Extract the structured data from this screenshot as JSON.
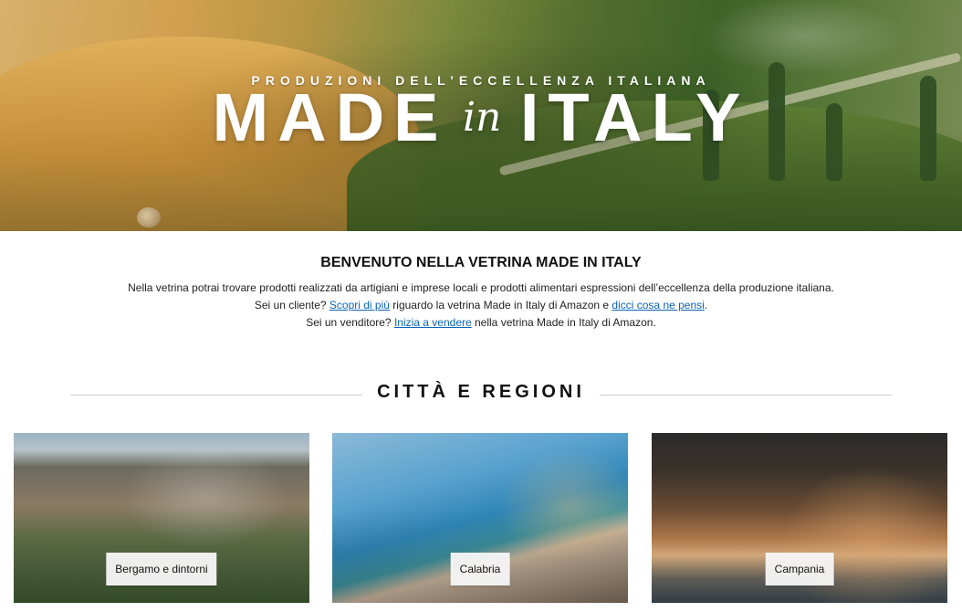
{
  "hero": {
    "subtitle": "PRODUZIONI DELL’ECCELLENZA ITALIANA",
    "title_left": "MADE",
    "title_middle": "in",
    "title_right": "ITALY"
  },
  "welcome": {
    "title": "BENVENUTO NELLA VETRINA MADE IN ITALY",
    "line1": "Nella vetrina potrai trovare prodotti realizzati da artigiani e imprese locali e prodotti alimentari espressioni dell’eccellenza della produzione italiana.",
    "line2_prefix": "Sei un cliente? ",
    "line2_link1": "Scopri di più",
    "line2_middle": " riguardo la vetrina Made in Italy di Amazon e ",
    "line2_link2": "dicci cosa ne pensi",
    "line2_suffix": ".",
    "line3_prefix": "Sei un venditore? ",
    "line3_link": "Inizia a vendere",
    "line3_suffix": " nella vetrina Made in Italy di Amazon."
  },
  "section": {
    "title": "CITTÀ E REGIONI"
  },
  "cards": [
    {
      "label": "Bergamo e dintorni"
    },
    {
      "label": "Calabria"
    },
    {
      "label": "Campania"
    }
  ],
  "colors": {
    "link": "#0b63b6",
    "divider": "#cfcfcf"
  }
}
